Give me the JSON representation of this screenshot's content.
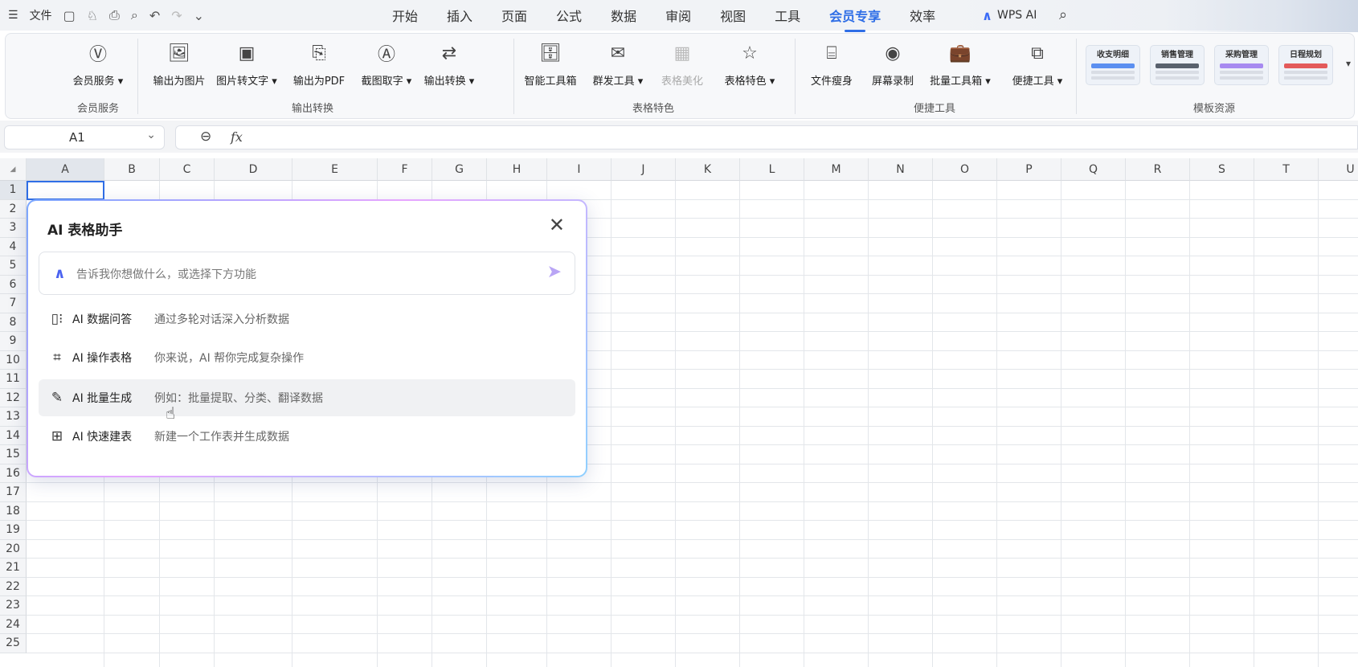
{
  "menubar": {
    "file_label": "文件",
    "tabs": [
      "开始",
      "插入",
      "页面",
      "公式",
      "数据",
      "审阅",
      "视图",
      "工具",
      "会员专享",
      "效率"
    ],
    "active_tab": "会员专享",
    "wps_ai_label": "WPS AI"
  },
  "ribbon": {
    "groups": [
      {
        "title": "会员服务",
        "buttons": [
          "会员服务"
        ]
      },
      {
        "title": "输出转换",
        "buttons": [
          "输出为图片",
          "图片转文字",
          "输出为PDF",
          "截图取字",
          "输出转换"
        ]
      },
      {
        "title": "表格特色",
        "buttons": [
          "智能工具箱",
          "群发工具",
          "表格美化",
          "表格特色"
        ]
      },
      {
        "title": "便捷工具",
        "buttons": [
          "文件瘦身",
          "屏幕录制",
          "批量工具箱",
          "便捷工具"
        ]
      },
      {
        "title": "模板资源",
        "templates": [
          "收支明细",
          "销售管理",
          "采购管理",
          "日程规划"
        ]
      }
    ]
  },
  "formula_bar": {
    "cell_ref": "A1",
    "fx_label": "fx"
  },
  "grid": {
    "columns": [
      "A",
      "B",
      "C",
      "D",
      "E",
      "F",
      "G",
      "H",
      "I",
      "J",
      "K",
      "L",
      "M",
      "N",
      "O",
      "P",
      "Q",
      "R",
      "S",
      "T",
      "U"
    ],
    "rows": [
      "1",
      "2",
      "3",
      "4",
      "5",
      "6",
      "7",
      "8",
      "9",
      "10",
      "11",
      "12",
      "13",
      "14",
      "15",
      "16",
      "17",
      "18",
      "19",
      "20",
      "21",
      "22",
      "23",
      "24",
      "25"
    ]
  },
  "ai_dialog": {
    "title": "AI 表格助手",
    "placeholder": "告诉我你想做什么，或选择下方功能",
    "items": [
      {
        "name": "AI 数据问答",
        "desc": "通过多轮对话深入分析数据"
      },
      {
        "name": "AI 操作表格",
        "desc": "你来说，AI 帮你完成复杂操作"
      },
      {
        "name": "AI 批量生成",
        "desc": "例如：批量提取、分类、翻译数据"
      },
      {
        "name": "AI 快速建表",
        "desc": "新建一个工作表并生成数据"
      }
    ]
  }
}
